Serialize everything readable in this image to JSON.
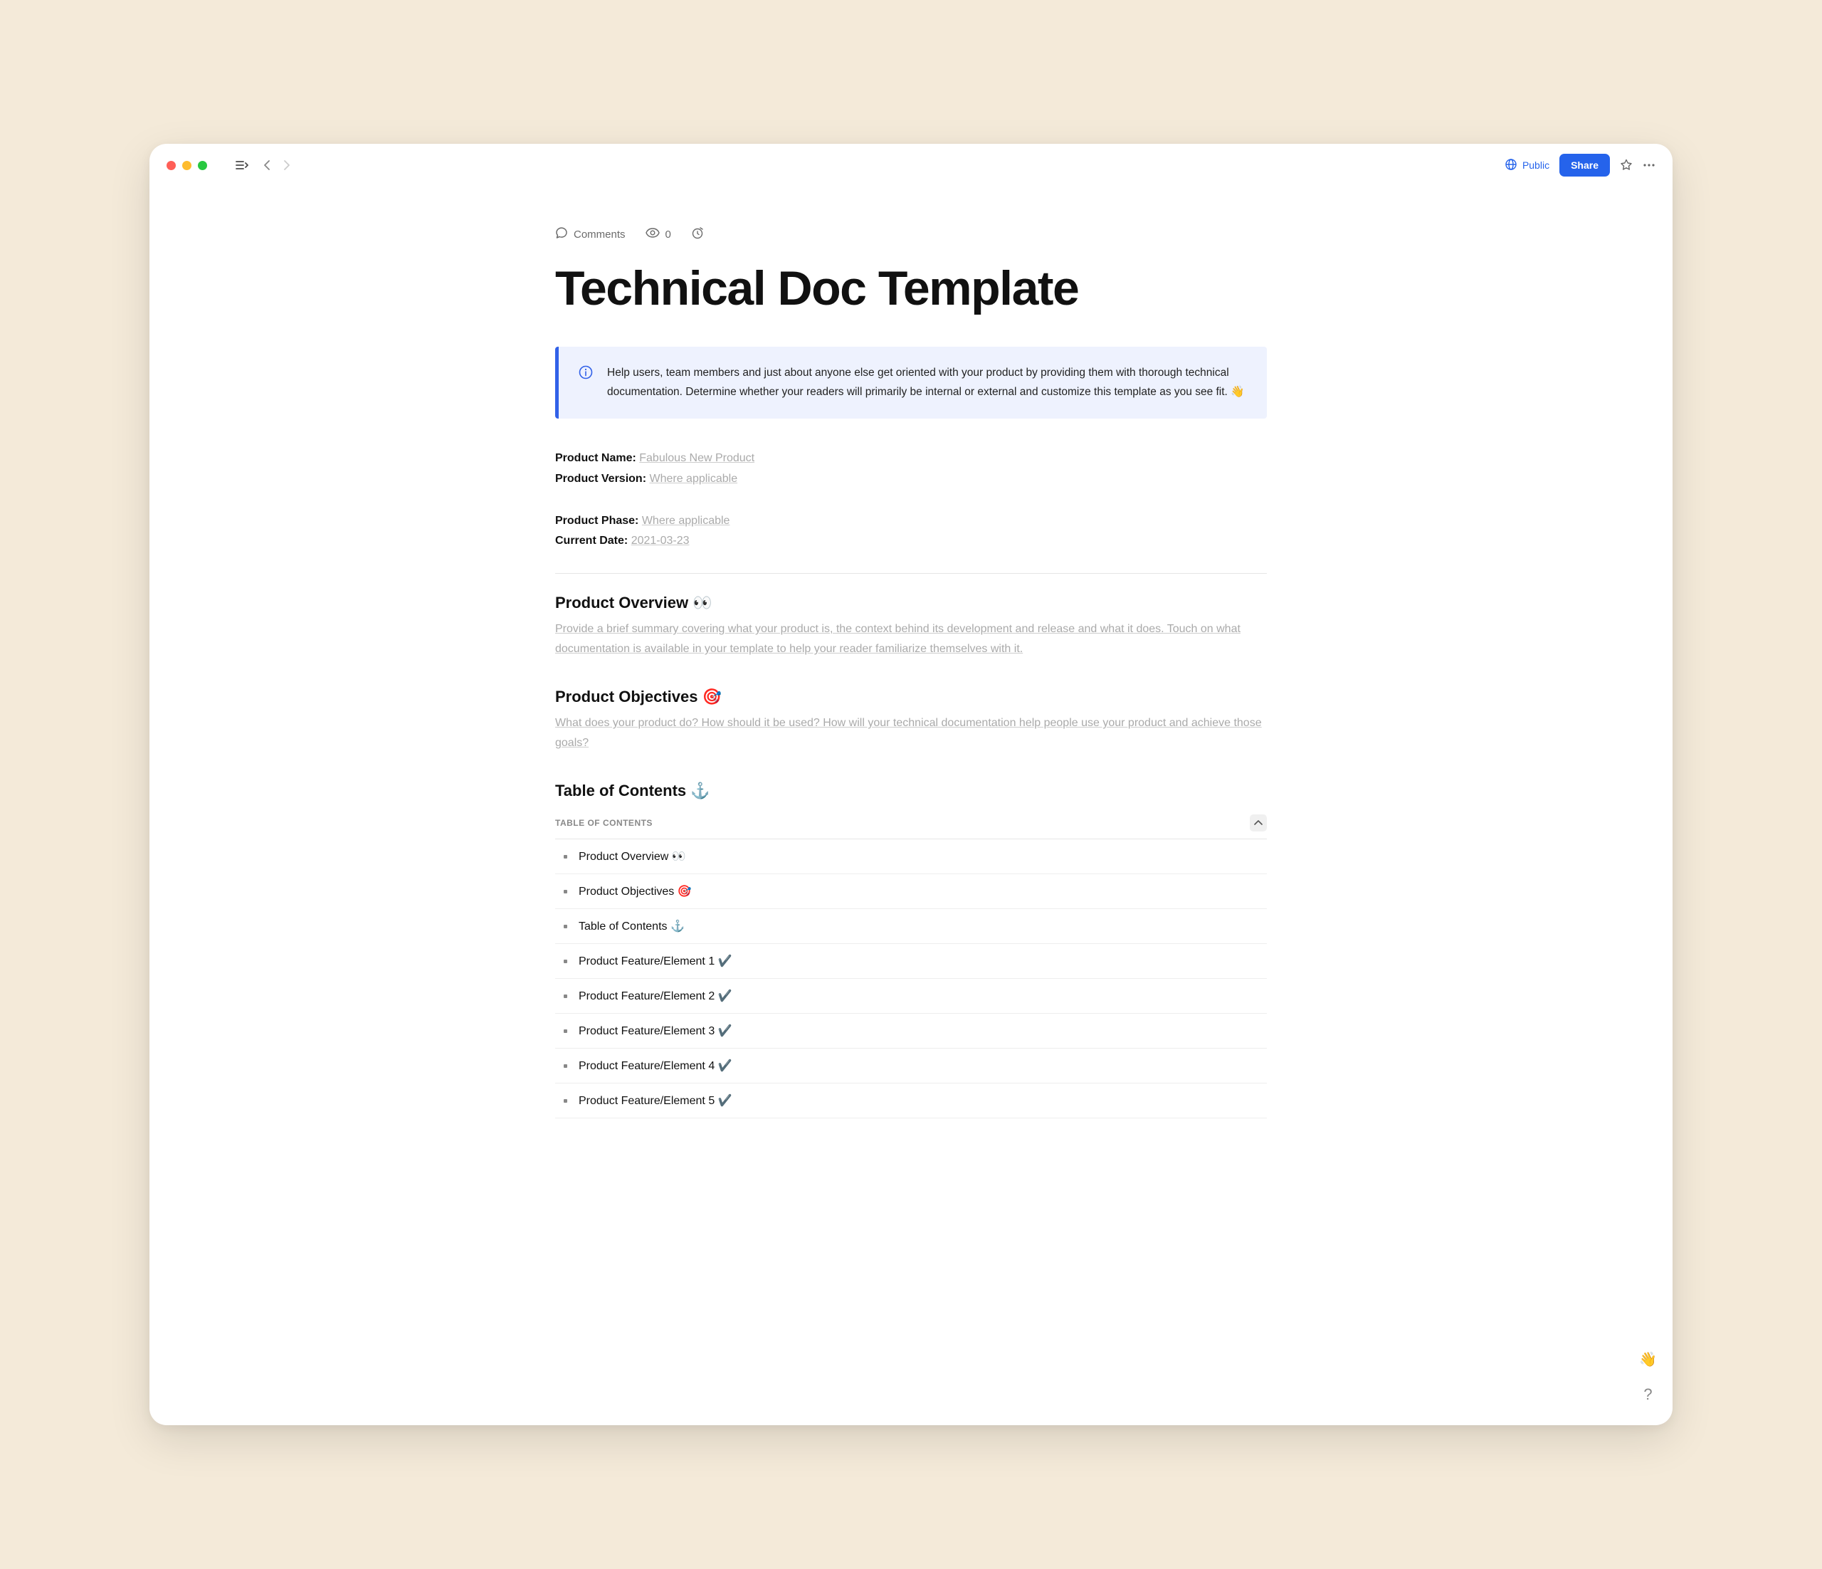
{
  "titlebar": {
    "public_label": "Public",
    "share_label": "Share"
  },
  "meta": {
    "comments_label": "Comments",
    "views_count": "0"
  },
  "doc": {
    "title": "Technical Doc Template",
    "callout": "Help users, team members and just about anyone else get oriented with your product by providing them with thorough technical documentation. Determine whether your readers will primarily be internal or external and customize this template as you see fit. 👋"
  },
  "fields": {
    "product_name_label": "Product Name:",
    "product_name_value": "Fabulous New Product",
    "product_version_label": "Product Version:",
    "product_version_value": "Where applicable",
    "product_phase_label": "Product Phase:",
    "product_phase_value": "Where applicable",
    "current_date_label": "Current Date:",
    "current_date_value": "2021-03-23"
  },
  "sections": {
    "overview_heading": "Product Overview 👀",
    "overview_placeholder": "Provide a brief summary covering what your product is, the context behind its development and release and what it does. Touch on what documentation is available in your template to help your reader familiarize themselves with it.",
    "objectives_heading": "Product Objectives 🎯",
    "objectives_placeholder": "What does your product do? How should it be used? How will your technical documentation help people use your product and achieve those goals?",
    "toc_heading": "Table of Contents ⚓"
  },
  "toc": {
    "header_label": "TABLE OF CONTENTS",
    "items": [
      "Product Overview 👀",
      "Product Objectives 🎯",
      "Table of Contents ⚓",
      "Product Feature/Element 1 ✔️",
      "Product Feature/Element 2 ✔️",
      "Product Feature/Element 3 ✔️",
      "Product Feature/Element 4 ✔️",
      "Product Feature/Element 5 ✔️"
    ]
  }
}
